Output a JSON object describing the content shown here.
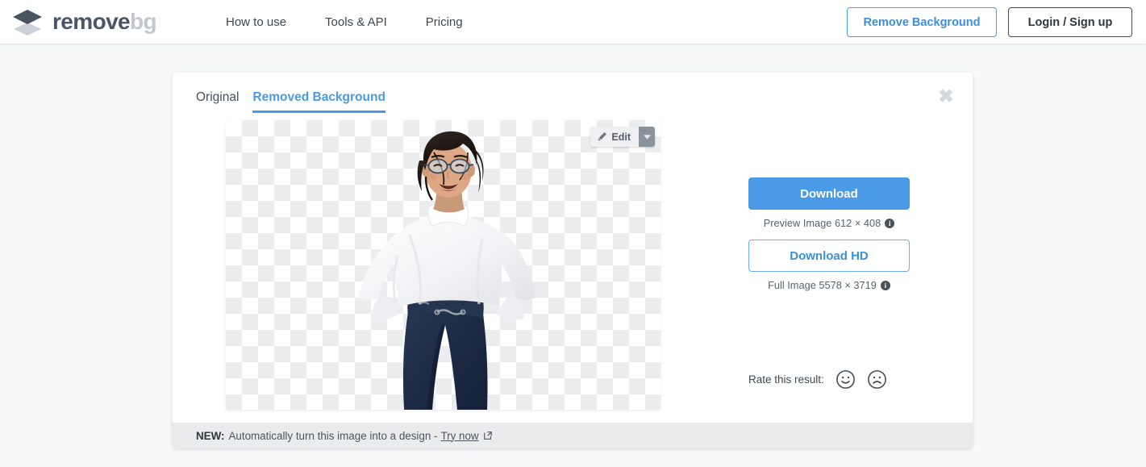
{
  "header": {
    "logo": {
      "icon": "layers-stack-icon",
      "text_primary": "remove",
      "text_secondary": "bg"
    },
    "nav": [
      {
        "label": "How to use",
        "name": "nav-how-to-use"
      },
      {
        "label": "Tools & API",
        "name": "nav-tools-api"
      },
      {
        "label": "Pricing",
        "name": "nav-pricing"
      }
    ],
    "remove_background_button": "Remove Background",
    "login_signup_button": "Login / Sign up"
  },
  "card": {
    "close_icon": "close-icon",
    "tabs": [
      {
        "label": "Original",
        "active": false
      },
      {
        "label": "Removed Background",
        "active": true
      }
    ],
    "preview": {
      "edit_button_label": "Edit",
      "edit_icon": "brush-icon",
      "dropdown_icon": "chevron-down-icon",
      "background": "transparency-checkerboard"
    },
    "downloads": {
      "download_label": "Download",
      "preview_caption": "Preview Image 612 × 408",
      "download_hd_label": "Download HD",
      "full_caption": "Full Image 5578 × 3719",
      "info_glyph": "i"
    },
    "rating": {
      "label": "Rate this result:",
      "positive_icon": "smiley-happy-icon",
      "negative_icon": "smiley-sad-icon"
    },
    "banner": {
      "badge": "NEW:",
      "text": "Automatically turn this image into a design -",
      "link": "Try now",
      "link_icon": "external-link-icon"
    }
  },
  "colors": {
    "accent_blue": "#4a9ae8",
    "logo_dark": "#4a5568",
    "logo_light": "#c3c8ce",
    "page_bg": "#f7f8f9",
    "banner_bg": "#eaebec"
  }
}
